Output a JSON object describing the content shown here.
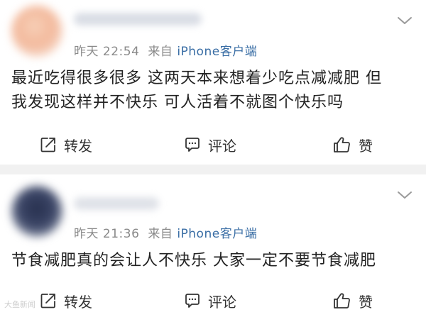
{
  "posts": [
    {
      "meta": {
        "time": "昨天 22:54",
        "from_label": "来自",
        "source": "iPhone客户端"
      },
      "body": [
        "最近吃得很多很多 这两天本来想着少吃点减减肥 但",
        "我发现这样并不快乐 可人活着不就图个快乐吗"
      ],
      "actions": {
        "repost": "转发",
        "comment": "评论",
        "like": "赞"
      }
    },
    {
      "meta": {
        "time": "昨天 21:36",
        "from_label": "来自",
        "source": "iPhone客户端"
      },
      "body": [
        "节食减肥真的会让人不快乐 大家一定不要节食减肥"
      ],
      "actions": {
        "repost": "转发",
        "comment": "评论",
        "like": "赞"
      }
    }
  ],
  "colors": {
    "source_link": "#3a6ea5",
    "meta_gray": "#8a8a8a",
    "separator": "#f1f1f1"
  },
  "icons": {
    "menu": "chevron-down-icon",
    "repost": "repost-icon",
    "comment": "comment-icon",
    "like": "thumbs-up-icon"
  },
  "watermark": "大鱼新闻"
}
